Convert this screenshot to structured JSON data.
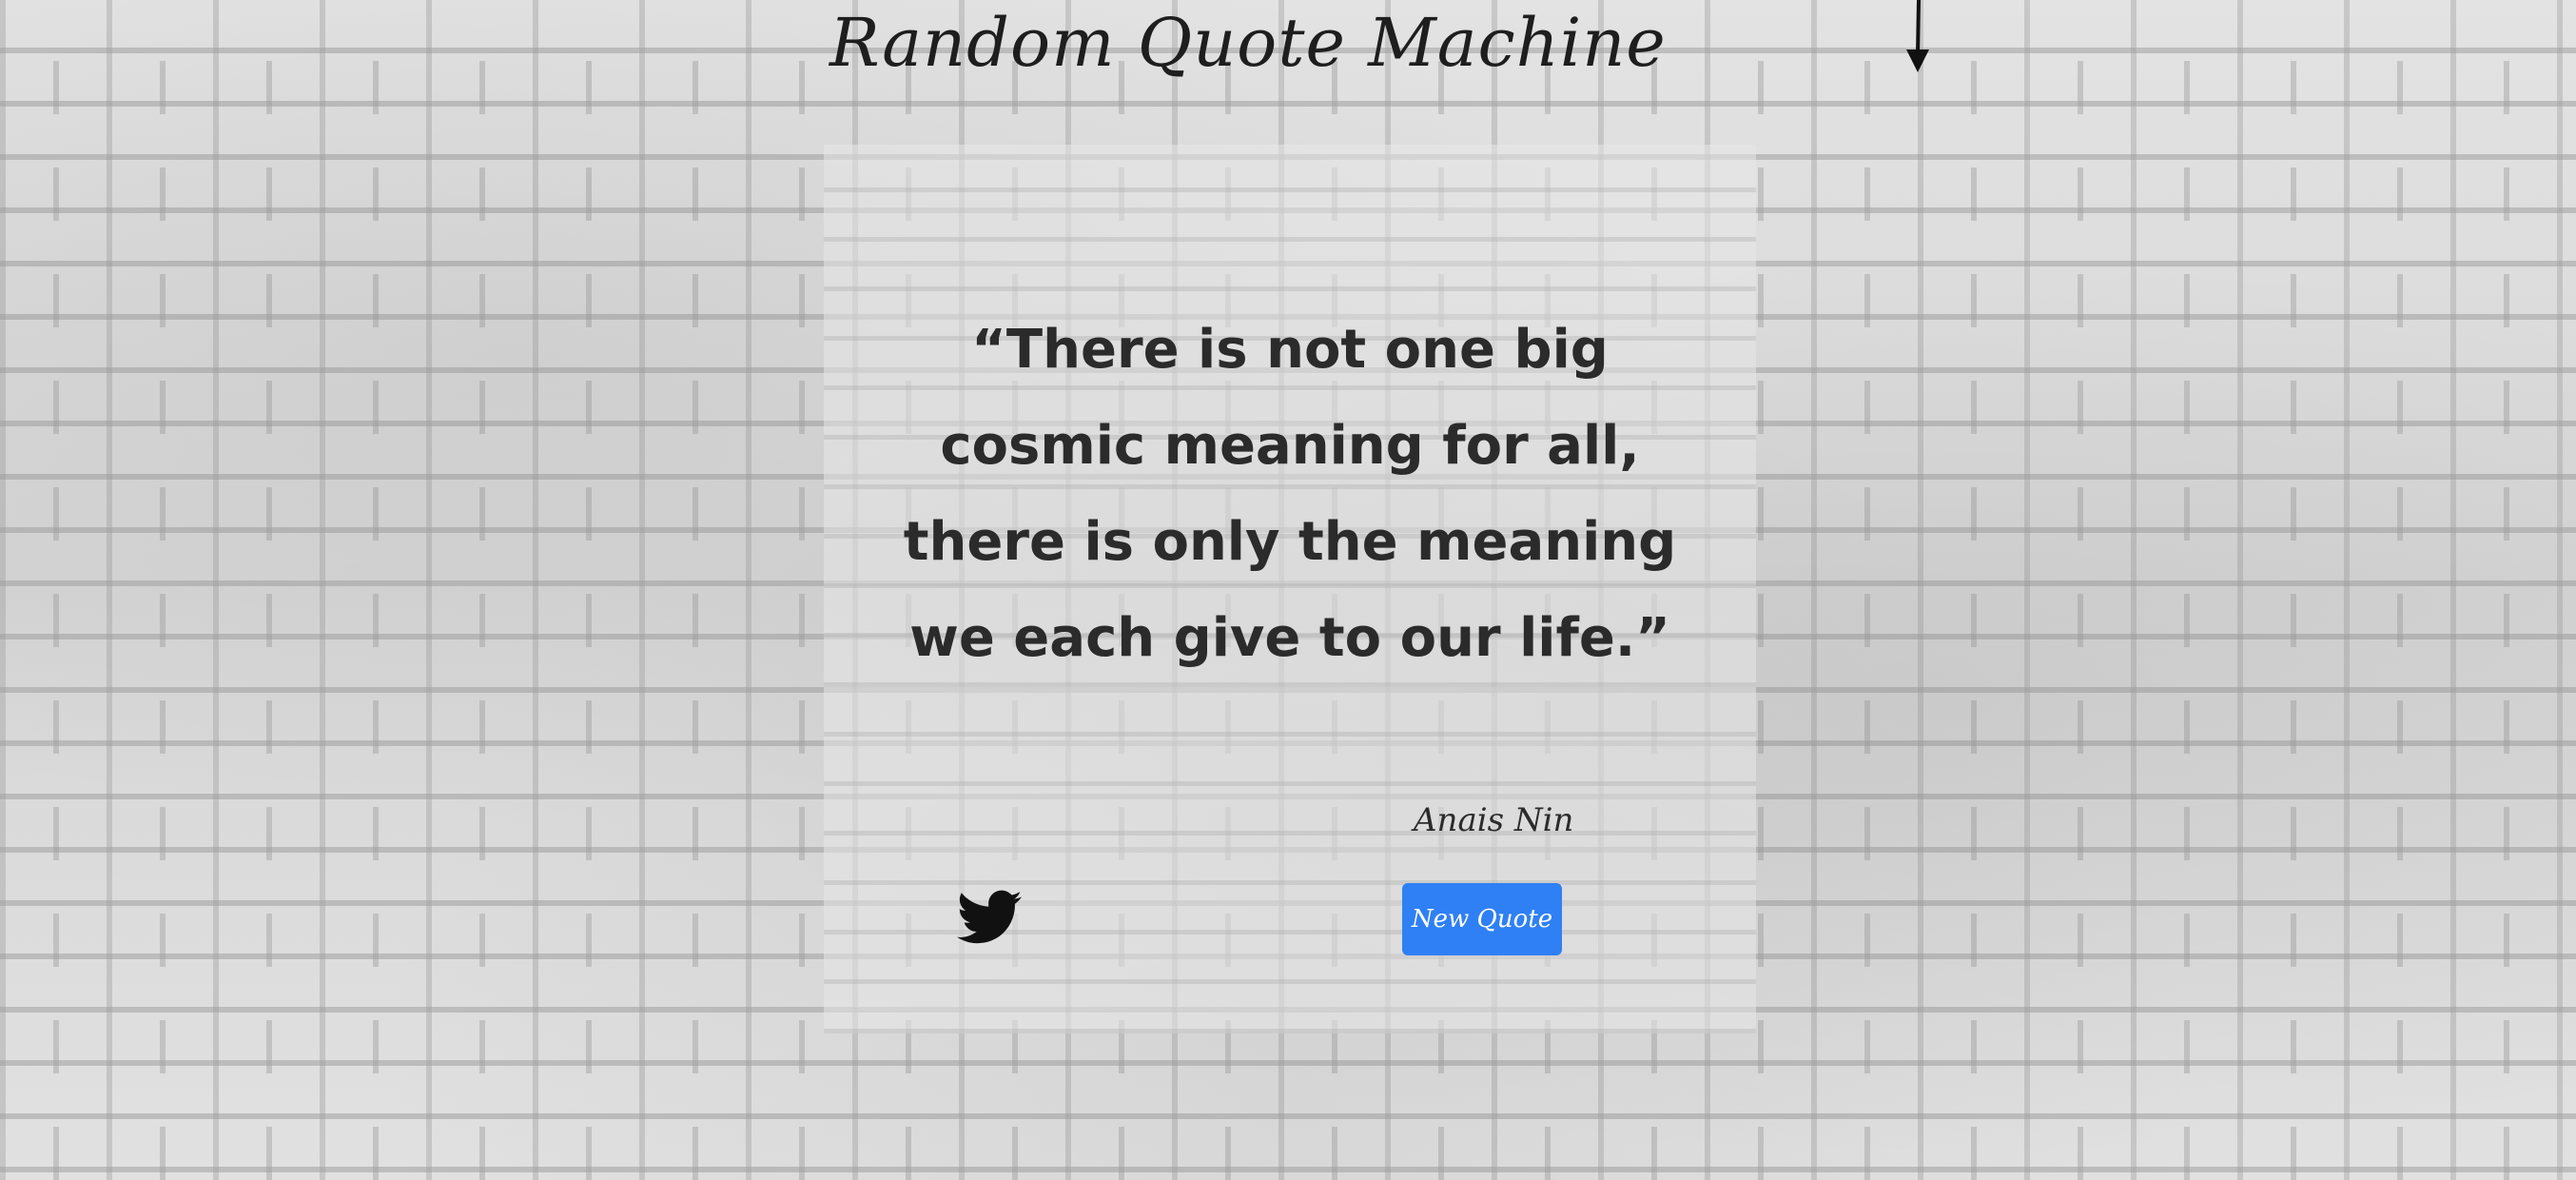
{
  "header": {
    "title": "Random Quote Machine"
  },
  "quote": {
    "text": "“There is not one big cosmic meaning for all, there is only the meaning we each give to our life.”",
    "author": "Anais Nin"
  },
  "actions": {
    "new_quote_label": "New Quote",
    "tweet_icon": "twitter-bird-icon"
  },
  "colors": {
    "button_bg": "#2f80f5",
    "button_text": "#ffffff",
    "text": "#2b2b2b"
  },
  "icons": {
    "arrow": "arrow-down-icon",
    "tweet": "twitter-icon"
  }
}
